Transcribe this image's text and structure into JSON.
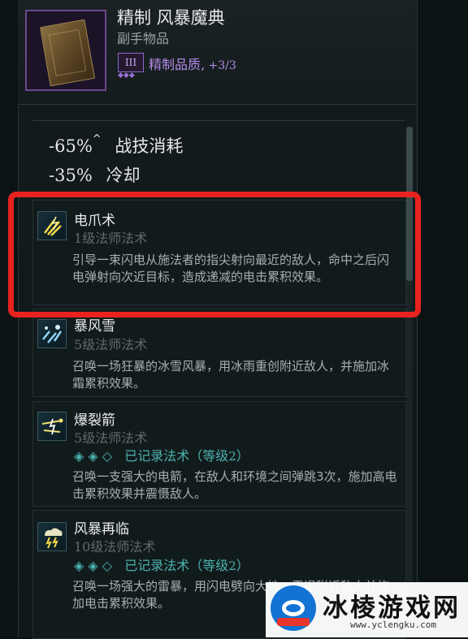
{
  "item": {
    "title": "精制 风暴魔典",
    "subtitle": "副手物品",
    "quality_badge": "III",
    "quality_stars": "◆◆◆",
    "quality_label": "精制品质,",
    "quality_level": " +3/3",
    "icon": "grimoire-book-icon"
  },
  "stats": [
    {
      "value": "-65%",
      "caret": "^",
      "label": "战技消耗"
    },
    {
      "value": "-35%",
      "caret": "",
      "label": "冷却"
    }
  ],
  "skills": [
    {
      "name": "电爪术",
      "level_num": "1",
      "level_text": "级法师法术",
      "desc": "引导一束闪电从施法者的指尖射向最近的敌人，命中之后闪电弹射向次近目标，造成递减的电击累积效果。",
      "icon": "lightning-claw-icon"
    },
    {
      "name": "暴风雪",
      "level_num": "5",
      "level_text": "级法师法术",
      "desc": "召唤一场狂暴的冰雪风暴，用冰雨重创附近敌人，并施加冰霜累积效果。",
      "icon": "blizzard-icon"
    },
    {
      "name": "爆裂箭",
      "level_num": "5",
      "level_text": "级法师法术",
      "record_diamonds": "◈ ◈ ◇",
      "record_text": "已记录法术（等级",
      "record_level": "2",
      "record_close": "）",
      "desc": "召唤一支强大的电箭，在敌人和环境之间弹跳3次，施加高电击累积效果并震慑敌人。",
      "icon": "lightning-arrow-icon"
    },
    {
      "name": "风暴再临",
      "level_num": "10",
      "level_text": "级法师法术",
      "record_diamonds": "◈ ◈ ◇",
      "record_text": "已记录法术（等级",
      "record_level": "2",
      "record_close": "）",
      "desc": "召唤一场强大的雷暴，用闪电劈向大地，震退附近敌人并施加电击累积效果。",
      "icon": "storm-cloud-icon"
    }
  ],
  "watermark": {
    "text": "冰棱游戏网",
    "url": "www.yclengku.com"
  },
  "colors": {
    "highlight": "#e8231f",
    "quality": "#b48ae8",
    "record": "#4bb2ad"
  }
}
